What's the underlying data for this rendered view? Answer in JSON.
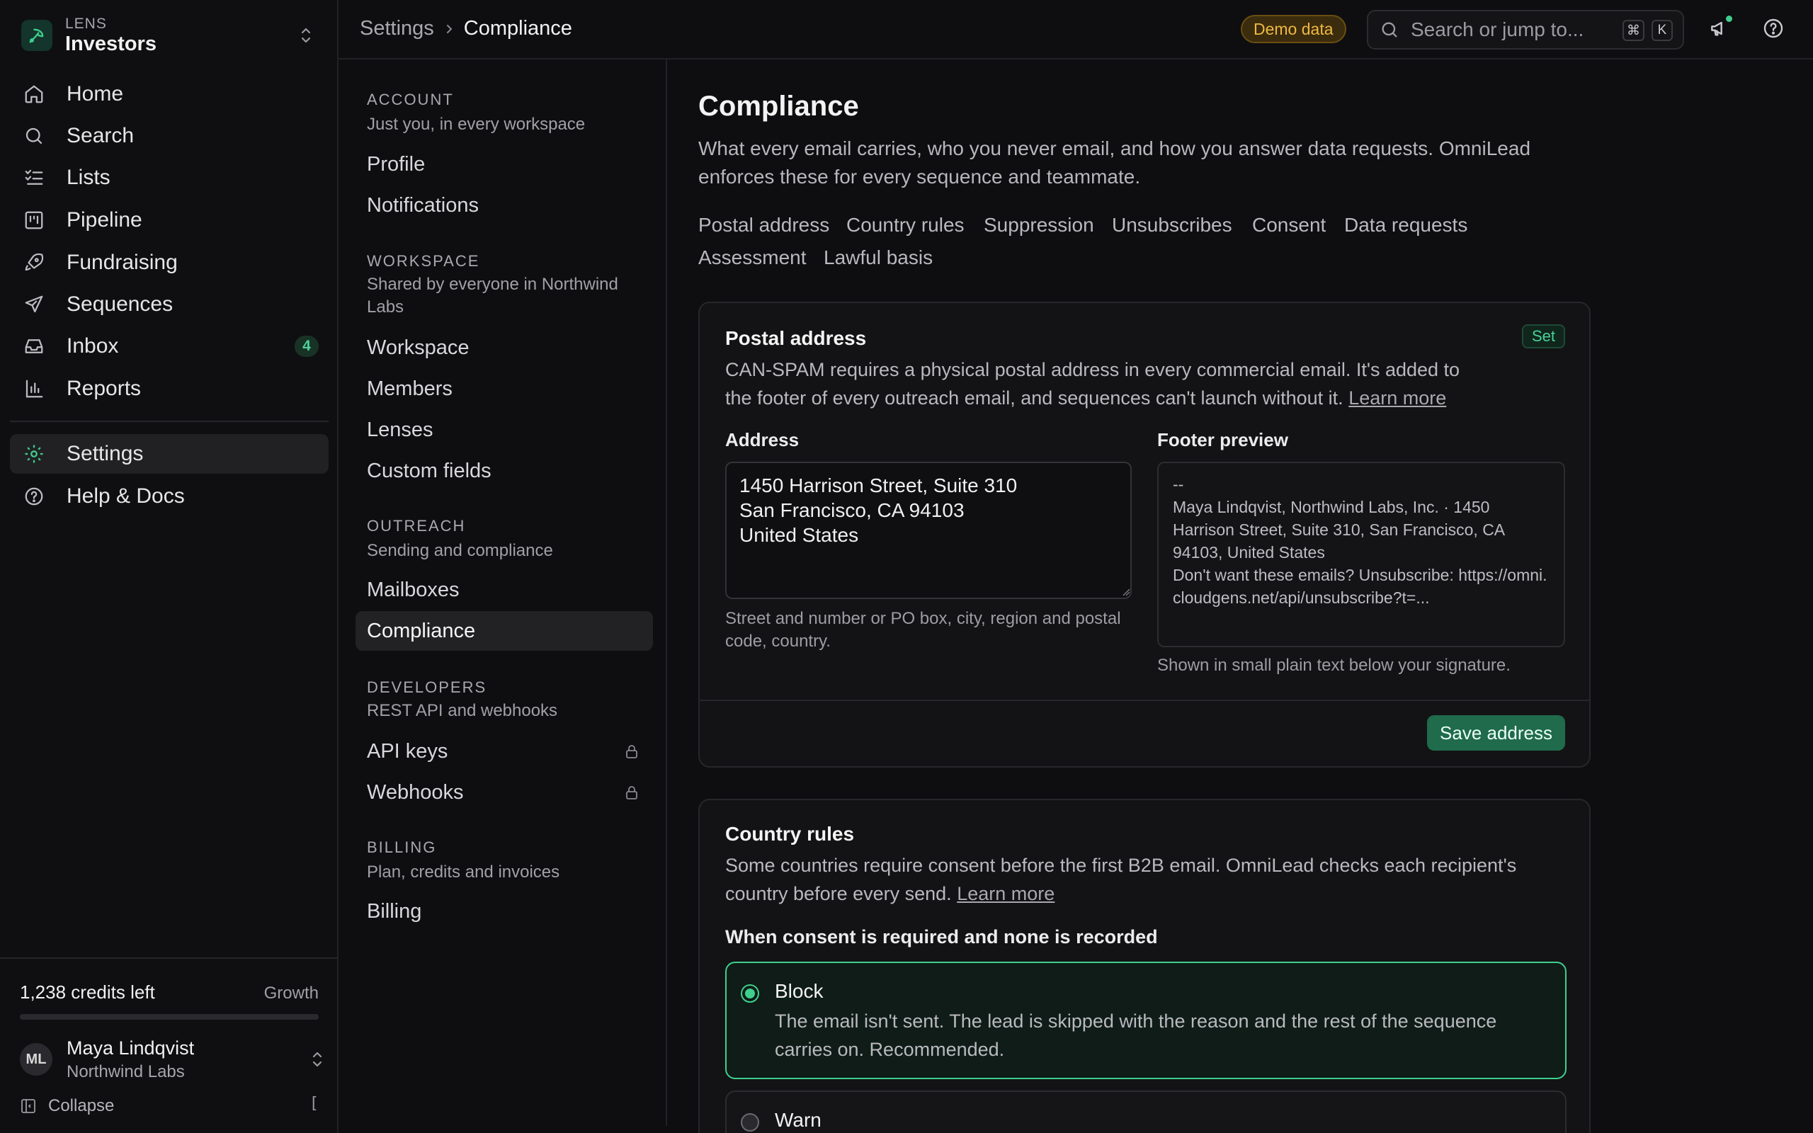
{
  "workspace": {
    "lens_label": "LENS",
    "name": "Investors"
  },
  "nav": {
    "home": "Home",
    "search": "Search",
    "lists": "Lists",
    "pipeline": "Pipeline",
    "fundraising": "Fundraising",
    "sequences": "Sequences",
    "inbox": "Inbox",
    "inbox_count": "4",
    "reports": "Reports",
    "settings": "Settings",
    "help": "Help & Docs"
  },
  "credits": {
    "text": "1,238 credits left",
    "plan": "Growth",
    "usage_fraction": 0.0
  },
  "user": {
    "initials": "ML",
    "name": "Maya Lindqvist",
    "org": "Northwind Labs"
  },
  "collapse": {
    "label": "Collapse",
    "shortcut": "["
  },
  "breadcrumb": {
    "parent": "Settings",
    "separator": "›",
    "current": "Compliance"
  },
  "topbar": {
    "demo_badge": "Demo data",
    "search_placeholder": "Search or jump to...",
    "kbd_cmd": "⌘",
    "kbd_k": "K"
  },
  "settings_nav": {
    "account": {
      "heading": "ACCOUNT",
      "sub": "Just you, in every workspace",
      "items": [
        "Profile",
        "Notifications"
      ]
    },
    "workspace": {
      "heading": "WORKSPACE",
      "sub": "Shared by everyone in Northwind Labs",
      "items": [
        "Workspace",
        "Members",
        "Lenses",
        "Custom fields"
      ]
    },
    "outreach": {
      "heading": "OUTREACH",
      "sub": "Sending and compliance",
      "items": [
        "Mailboxes",
        "Compliance"
      ]
    },
    "developers": {
      "heading": "DEVELOPERS",
      "sub": "REST API and webhooks",
      "items": [
        "API keys",
        "Webhooks"
      ]
    },
    "billing": {
      "heading": "BILLING",
      "sub": "Plan, credits and invoices",
      "items": [
        "Billing"
      ]
    }
  },
  "page": {
    "title": "Compliance",
    "description": "What every email carries, who you never email, and how you answer data requests. OmniLead enforces these for every sequence and teammate.",
    "anchors": [
      "Postal address",
      "Country rules",
      "Suppression",
      "Unsubscribes",
      "Consent",
      "Data requests",
      "Assessment",
      "Lawful basis"
    ]
  },
  "postal": {
    "title": "Postal address",
    "badge": "Set",
    "description": "CAN-SPAM requires a physical postal address in every commercial email. It's added to the footer of every outreach email, and sequences can't launch without it.",
    "learn_more": "Learn more",
    "address_label": "Address",
    "address_value": "1450 Harrison Street, Suite 310\nSan Francisco, CA 94103\nUnited States",
    "address_hint": "Street and number or PO box, city, region and postal code, country.",
    "preview_label": "Footer preview",
    "preview_lines": [
      "--",
      "Maya Lindqvist, Northwind Labs, Inc. · 1450 Harrison Street, Suite 310, San Francisco, CA 94103, United States",
      "Don't want these emails? Unsubscribe: https://omni.cloudgens.net/api/unsubscribe?t=..."
    ],
    "preview_hint": "Shown in small plain text below your signature.",
    "save_label": "Save address"
  },
  "country": {
    "title": "Country rules",
    "description": "Some countries require consent before the first B2B email. OmniLead checks each recipient's country before every send.",
    "learn_more": "Learn more",
    "question": "When consent is required and none is recorded",
    "options": [
      {
        "title": "Block",
        "desc": "The email isn't sent. The lead is skipped with the reason and the rest of the sequence carries on. Recommended."
      },
      {
        "title": "Warn",
        "desc": ""
      }
    ]
  },
  "colors": {
    "accent": "#3fcf8e",
    "demo_badge": "#f0b842",
    "background": "#0e0e10",
    "card": "#131315"
  }
}
